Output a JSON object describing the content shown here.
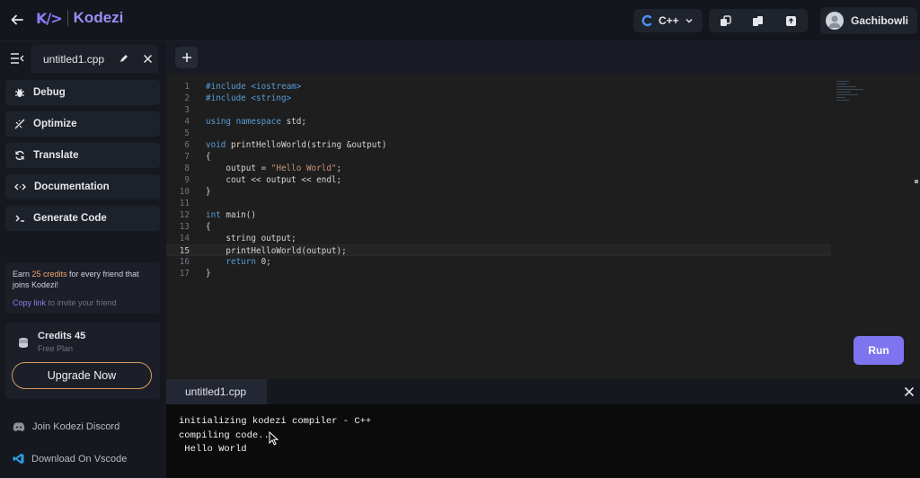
{
  "header": {
    "logo_mark": "K/>",
    "logo_text": "Kodezi",
    "language": "C++",
    "user_name": "Gachibowli"
  },
  "tabs": {
    "file_tab": "untitled1.cpp"
  },
  "sidebar": {
    "items": [
      {
        "label": "Debug",
        "icon": "bug-icon"
      },
      {
        "label": "Optimize",
        "icon": "optimize-icon"
      },
      {
        "label": "Translate",
        "icon": "refresh-icon"
      },
      {
        "label": "Documentation",
        "icon": "code-brackets-icon"
      },
      {
        "label": "Generate Code",
        "icon": "terminal-prompt-icon"
      }
    ],
    "promo": {
      "text_before": "Earn ",
      "credits_amount": "25 credits",
      "text_after": " for every friend that joins Kodezi!",
      "link_label": "Copy link",
      "link_suffix": " to invite your friend"
    },
    "credits": {
      "title": "Credits 45",
      "plan": "Free Plan",
      "upgrade_label": "Upgrade Now"
    },
    "footer": {
      "discord_label": "Join Kodezi Discord",
      "vscode_label": "Download On Vscode"
    }
  },
  "editor": {
    "active_line": 15,
    "lines": [
      {
        "n": "1",
        "code": "#include <iostream>"
      },
      {
        "n": "2",
        "code": "#include <string>"
      },
      {
        "n": "3",
        "code": ""
      },
      {
        "n": "4",
        "code": "using namespace std;"
      },
      {
        "n": "5",
        "code": ""
      },
      {
        "n": "6",
        "code": "void printHelloWorld(string &output)"
      },
      {
        "n": "7",
        "code": "{"
      },
      {
        "n": "8",
        "code": "    output = \"Hello World\";"
      },
      {
        "n": "9",
        "code": "    cout << output << endl;"
      },
      {
        "n": "10",
        "code": "}"
      },
      {
        "n": "11",
        "code": ""
      },
      {
        "n": "12",
        "code": "int main()"
      },
      {
        "n": "13",
        "code": "{"
      },
      {
        "n": "14",
        "code": "    string output;"
      },
      {
        "n": "15",
        "code": "    printHelloWorld(output);"
      },
      {
        "n": "16",
        "code": "    return 0;"
      },
      {
        "n": "17",
        "code": "}"
      }
    ],
    "run_label": "Run"
  },
  "terminal": {
    "tab_label": "untitled1.cpp",
    "lines": [
      "initializing kodezi compiler - C++",
      "compiling code...",
      " Hello World"
    ]
  },
  "colors": {
    "accent": "#8b7cf6",
    "run_button": "#7f74ef",
    "upgrade_border": "#d79a5c",
    "keyword": "#569cd6",
    "string": "#ce9178"
  }
}
